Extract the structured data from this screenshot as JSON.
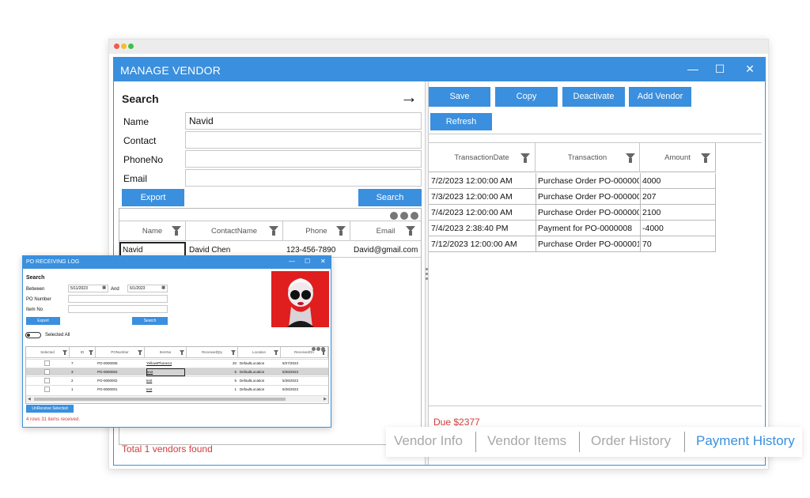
{
  "window": {
    "title": "MANAGE VENDOR"
  },
  "search": {
    "heading": "Search",
    "fields": [
      {
        "label": "Name",
        "value": "Navid"
      },
      {
        "label": "Contact",
        "value": ""
      },
      {
        "label": "PhoneNo",
        "value": ""
      },
      {
        "label": "Email",
        "value": ""
      }
    ],
    "export_label": "Export",
    "search_label": "Search"
  },
  "vendor_grid": {
    "columns": [
      "Name",
      "ContactName",
      "Phone",
      "Email"
    ],
    "rows": [
      [
        "Navid",
        "David Chen",
        "123-456-7890",
        "David@gmail.com"
      ]
    ]
  },
  "total_text": "Total 1 vendors found",
  "toolbar": {
    "save": "Save",
    "copy": "Copy",
    "deactivate": "Deactivate",
    "add_vendor": "Add Vendor",
    "refresh": "Refresh"
  },
  "payment_grid": {
    "columns": [
      "TransactionDate",
      "Transaction",
      "Amount"
    ],
    "rows": [
      [
        "7/2/2023 12:00:00 AM",
        "Purchase Order PO-000000",
        "4000"
      ],
      [
        "7/3/2023 12:00:00 AM",
        "Purchase Order PO-000000",
        "207"
      ],
      [
        "7/4/2023 12:00:00 AM",
        "Purchase Order PO-000000",
        "2100"
      ],
      [
        "7/4/2023 2:38:40 PM",
        "Payment for PO-0000008",
        "-4000"
      ],
      [
        "7/12/2023 12:00:00 AM",
        "Purchase Order PO-000001",
        "70"
      ]
    ]
  },
  "due_text": "Due $2377",
  "tabs": [
    "Vendor Info",
    "Vendor Items",
    "Order History",
    "Payment History"
  ],
  "colors": {
    "accent": "#3a8fde",
    "danger": "#d23b3b",
    "active_tab": "#3a8fde",
    "inactive_tab": "#a8a8a8"
  },
  "popup": {
    "title": "PO RECEIVING LOG",
    "search_heading": "Search",
    "between_label": "Between",
    "from_date": "5/11/2023",
    "and_label": "And",
    "to_date": "6/1/2023",
    "po_number_label": "PO Number",
    "item_no_label": "Item No",
    "export_label": "Export",
    "search_label": "Search",
    "selected_all_label": "Selected All",
    "columns": [
      "Selected",
      "ID",
      "PONumber",
      "ItemNo",
      "ReceivedQty",
      "Location",
      "ReceivedOn"
    ],
    "rows": [
      [
        "",
        "7",
        "PO-0000005",
        "YellowIPhone14",
        "20",
        "DefaultLocation",
        "5/27/2023"
      ],
      [
        "",
        "3",
        "PO-0000002",
        "test",
        "5",
        "DefaultLocation",
        "5/26/2023"
      ],
      [
        "",
        "2",
        "PO-0000002",
        "test",
        "5",
        "DefaultLocation",
        "5/26/2023"
      ],
      [
        "",
        "1",
        "PO-0000001",
        "test",
        "1",
        "DefaultLocation",
        "5/26/2023"
      ]
    ],
    "unreceive_label": "UnReceive Selected",
    "status_text": "4 rows 31 items received."
  }
}
